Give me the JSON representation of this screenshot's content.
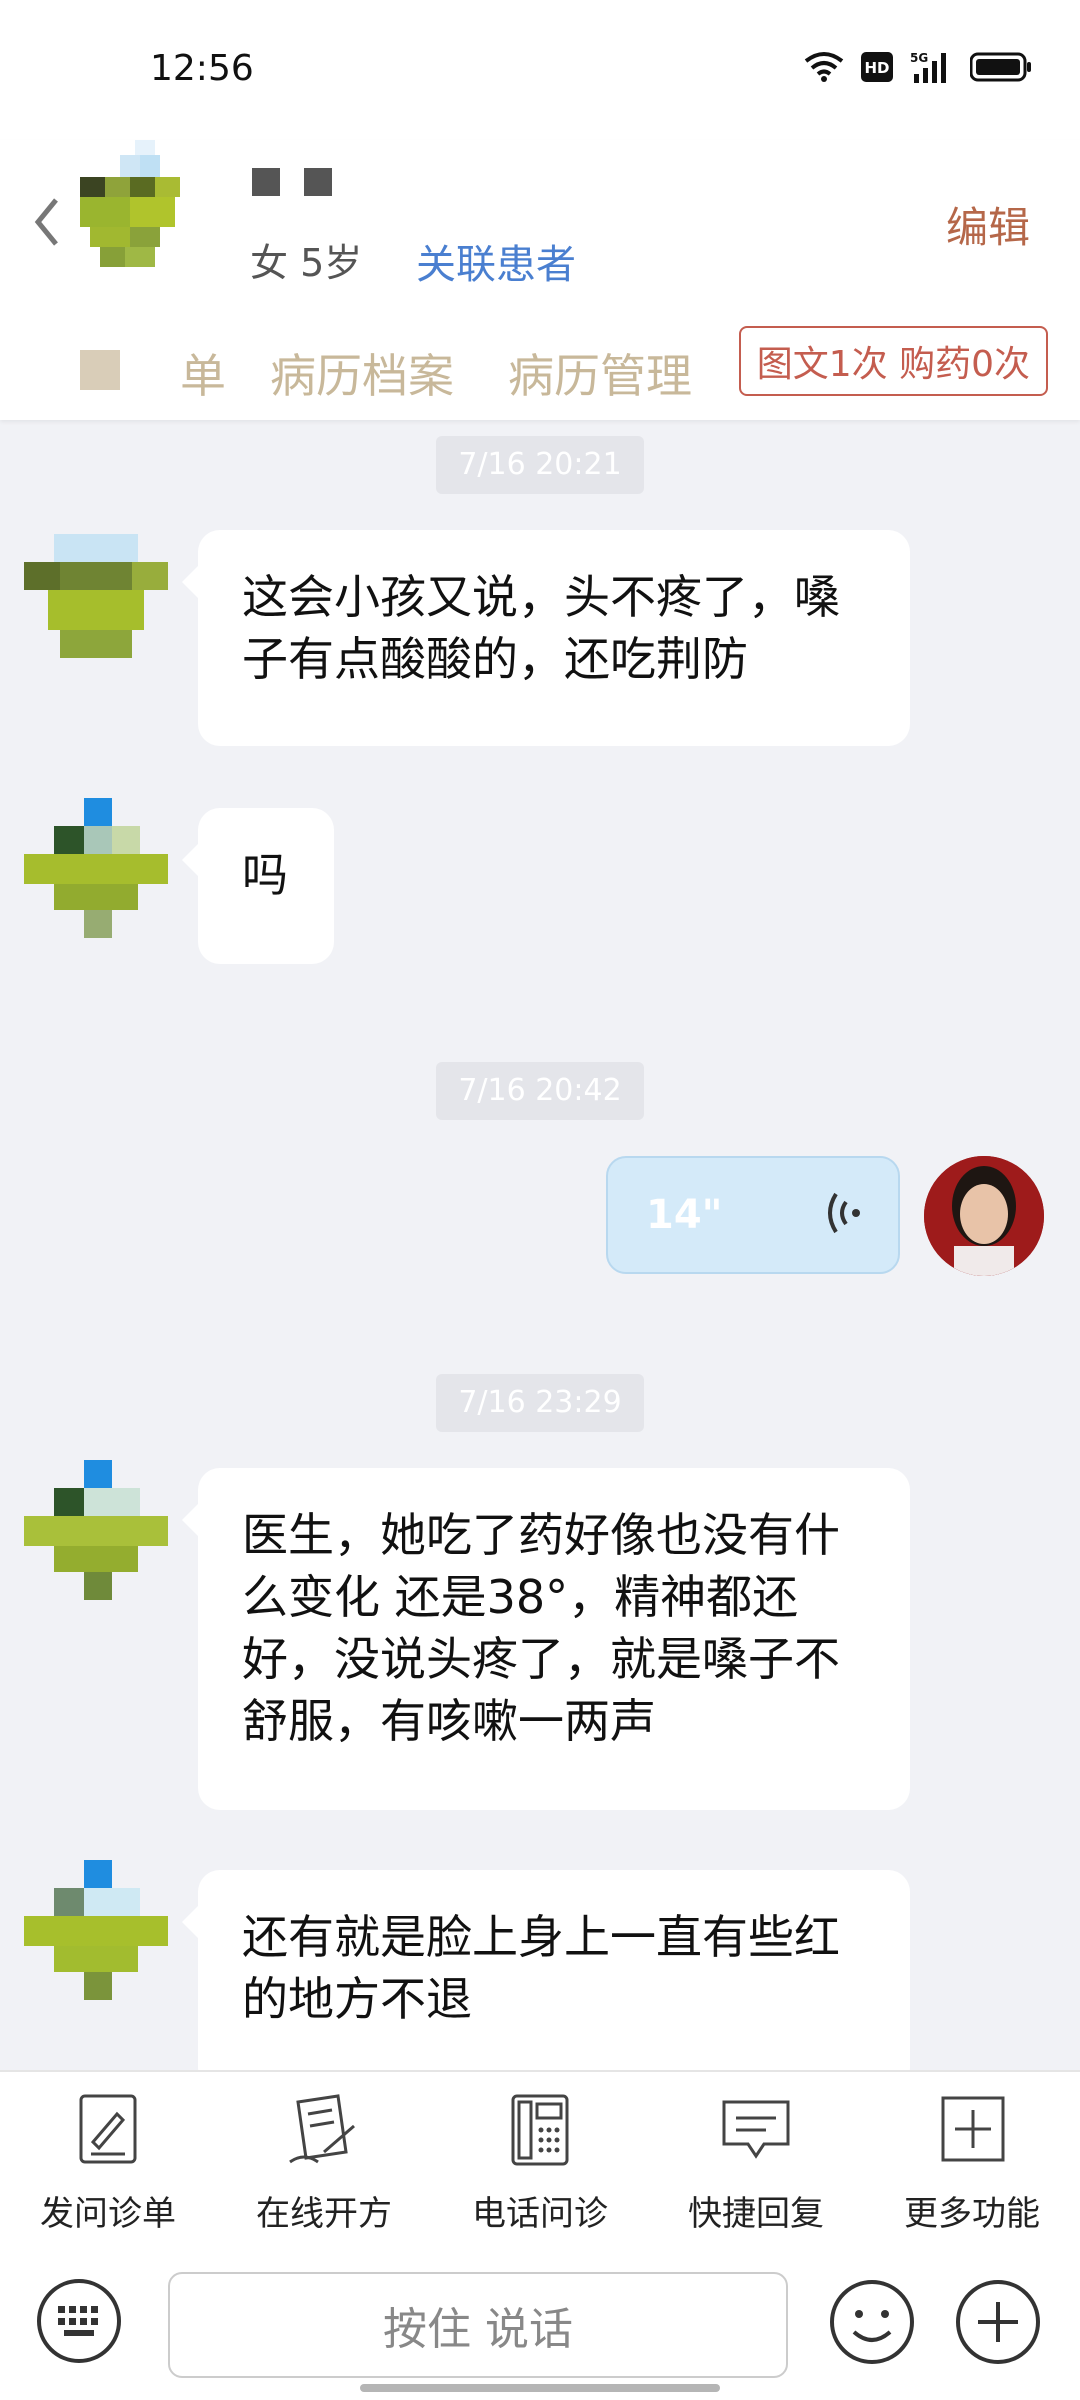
{
  "status_bar": {
    "time": "12:56",
    "icons": [
      "wifi-icon",
      "hd-icon",
      "5g-signal-icon",
      "battery-icon"
    ],
    "hd_label": "HD",
    "net_label": "5G"
  },
  "header": {
    "patient_info": "女 5岁",
    "link_patient": "关联患者",
    "edit": "编辑",
    "tabs": [
      "单",
      "病历档案",
      "病历管理"
    ],
    "promo": "图文1次 购药0次"
  },
  "chat": {
    "messages": [
      {
        "type": "timestamp",
        "text": "7/16 20:21"
      },
      {
        "type": "incoming",
        "text": "这会小孩又说，头不疼了，嗓子有点酸酸的，还吃荆防"
      },
      {
        "type": "incoming",
        "text": "吗"
      },
      {
        "type": "timestamp",
        "text": "7/16 20:42"
      },
      {
        "type": "outgoing_voice",
        "duration": "14\""
      },
      {
        "type": "timestamp",
        "text": "7/16 23:29"
      },
      {
        "type": "incoming",
        "text": "医生，她吃了药好像也没有什么变化 还是38°，精神都还好，没说头疼了，就是嗓子不舒服，有咳嗽一两声"
      },
      {
        "type": "incoming",
        "text": "还有就是脸上身上一直有些红的地方不退"
      }
    ]
  },
  "toolbar": {
    "items": [
      {
        "label": "发问诊单",
        "icon": "form-icon"
      },
      {
        "label": "在线开方",
        "icon": "prescription-icon"
      },
      {
        "label": "电话问诊",
        "icon": "phone-icon"
      },
      {
        "label": "快捷回复",
        "icon": "quick-reply-icon"
      },
      {
        "label": "更多功能",
        "icon": "more-icon"
      }
    ]
  },
  "input": {
    "hold_to_talk": "按住 说话"
  },
  "colors": {
    "accent": "#4a7fd0",
    "edit": "#b56749",
    "promo": "#c45d4f",
    "tab": "#c8b89a",
    "voice_bubble": "#d4eaf9"
  }
}
